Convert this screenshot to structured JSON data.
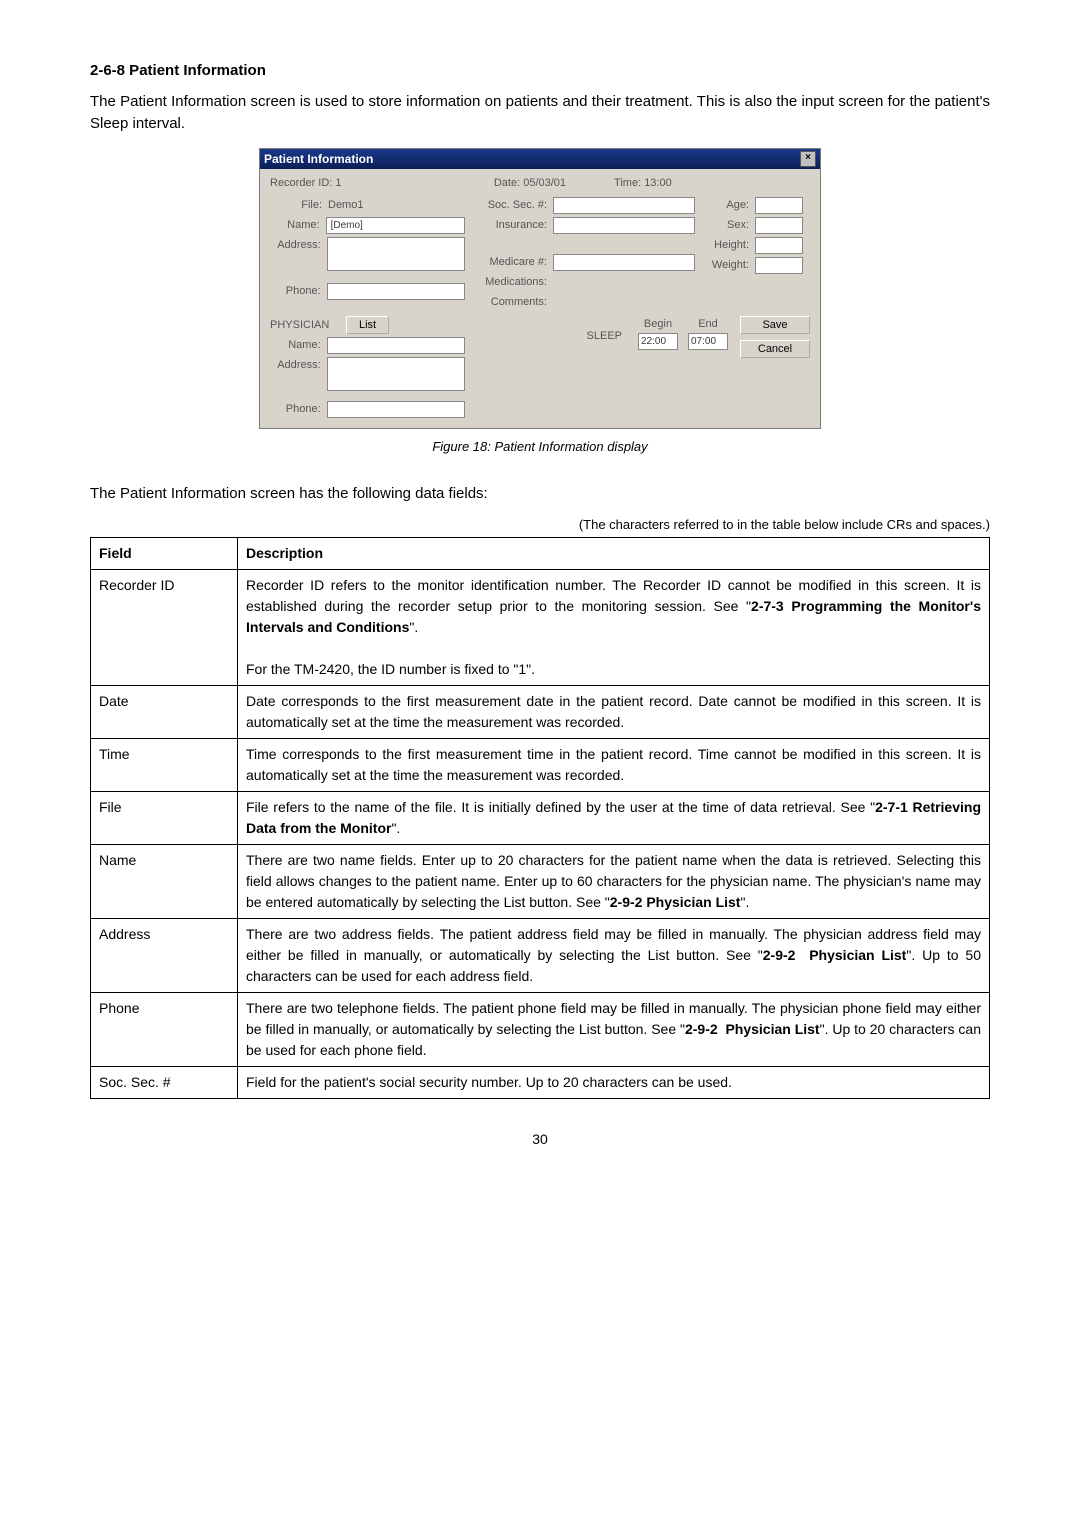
{
  "section": {
    "heading": "2-6-8 Patient Information",
    "intro": "The Patient Information screen is used to store information on patients and their treatment. This is also the input screen for the patient's Sleep interval."
  },
  "dialog": {
    "title": "Patient Information",
    "recorder_id_label": "Recorder ID:",
    "recorder_id_value": "1",
    "date_label": "Date:",
    "date_value": "05/03/01",
    "time_label": "Time:",
    "time_value": "13:00",
    "file_label": "File:",
    "file_value": "Demo1",
    "soc_sec_label": "Soc. Sec. #:",
    "name_label": "Name:",
    "name_value": "[Demo]",
    "insurance_label": "Insurance:",
    "address_label": "Address:",
    "medicare_label": "Medicare #:",
    "medications_label": "Medications:",
    "comments_label": "Comments:",
    "phone_label": "Phone:",
    "age_label": "Age:",
    "sex_label": "Sex:",
    "height_label": "Height:",
    "weight_label": "Weight:",
    "physician_label": "PHYSICIAN",
    "list_btn": "List",
    "phys_name_label": "Name:",
    "phys_address_label": "Address:",
    "phys_phone_label": "Phone:",
    "sleep_label": "SLEEP",
    "begin_label": "Begin",
    "begin_value": "22:00",
    "end_label": "End",
    "end_value": "07:00",
    "save_btn": "Save",
    "cancel_btn": "Cancel"
  },
  "figure_caption": "Figure 18: Patient Information display",
  "fields_intro": "The Patient Information screen has the following data fields:",
  "table_note": "(The characters referred to in the table below include CRs and spaces.)",
  "table": {
    "header_field": "Field",
    "header_desc": "Description",
    "rows": [
      {
        "field": "Recorder ID",
        "desc_html": "Recorder ID refers to the monitor identification number. The Recorder ID cannot be modified in this screen. It is established during the recorder setup prior to the monitoring session. See \"<b>2-7-3 Programming the Monitor's Intervals and Conditions</b>\".<br><br>For the TM-2420, the ID number is fixed to \"1\"."
      },
      {
        "field": "Date",
        "desc_html": "Date corresponds to the first measurement date in the patient record. Date cannot be modified in this screen. It is automatically set at the time the measurement was recorded."
      },
      {
        "field": "Time",
        "desc_html": "Time corresponds to the first measurement time in the patient record. Time cannot be modified in this screen. It is automatically set at the time the measurement was recorded."
      },
      {
        "field": "File",
        "desc_html": "File refers to the name of the file. It is initially defined by the user at the time of data retrieval. See \"<b>2-7-1 Retrieving Data from the Monitor</b>\"."
      },
      {
        "field": "Name",
        "desc_html": "There are two name fields. Enter up to 20 characters for the patient name when the data is retrieved. Selecting this field allows changes to the patient name. Enter up to 60 characters for the physician name. The physician's name may be entered automatically by selecting the List button. See \"<b>2-9-2 Physician List</b>\"."
      },
      {
        "field": "Address",
        "desc_html": "There are two address fields. The patient address field may be filled in manually. The physician address field may either be filled in manually, or automatically by selecting the List button. See \"<b>2-9-2&nbsp;&nbsp;Physician List</b>\". Up to 50 characters can be used for each address field."
      },
      {
        "field": "Phone",
        "desc_html": "There are two telephone fields. The patient phone field may be filled in manually. The physician phone field may either be filled in manually, or automatically by selecting the List button. See \"<b>2-9-2&nbsp;&nbsp;Physician List</b>\". Up to 20 characters can be used for each phone field."
      },
      {
        "field": "Soc. Sec. #",
        "desc_html": "Field for the patient's social security number. Up to 20 characters can be used."
      }
    ]
  },
  "page_number": "30"
}
